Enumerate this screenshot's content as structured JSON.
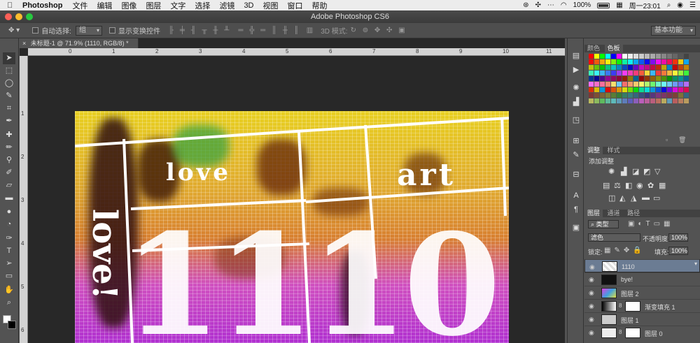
{
  "menubar": {
    "app_name": "Photoshop",
    "items": [
      "文件",
      "编辑",
      "图像",
      "图层",
      "文字",
      "选择",
      "滤镜",
      "3D",
      "视图",
      "窗口",
      "帮助"
    ],
    "battery": "100%",
    "clock": "周一23:01"
  },
  "titlebar": {
    "title": "Adobe Photoshop CS6"
  },
  "options": {
    "auto_select_label": "自动选择:",
    "auto_select_value": "组",
    "show_transform_label": "显示变换控件",
    "mode_3d_label": "3D 模式:",
    "workspace": "基本功能"
  },
  "document": {
    "tab_title": "未标题-1 @ 71.9% (1110, RGB/8) *",
    "ruler_top": [
      "0",
      "1",
      "2",
      "3",
      "4",
      "5",
      "6",
      "7",
      "8",
      "9",
      "10",
      "11"
    ],
    "ruler_left": [
      "1",
      "2",
      "3",
      "4",
      "5",
      "6"
    ],
    "artwork_texts": [
      "love",
      "art",
      "1110",
      "love!"
    ]
  },
  "panels": {
    "color_tabs": [
      "颜色",
      "色板"
    ],
    "adjust_tabs": [
      "调整",
      "样式"
    ],
    "adjust_title": "添加调整",
    "layers_tabs": [
      "图层",
      "通道",
      "路径"
    ],
    "filter_kind": "类型",
    "blend_mode": "滤色",
    "opacity_label": "不透明度:",
    "opacity_value": "100%",
    "lock_label": "锁定:",
    "fill_label": "填充:",
    "fill_value": "100%",
    "layers": [
      {
        "name": "1110"
      },
      {
        "name": "bye!"
      },
      {
        "name": "图层 2"
      },
      {
        "name": "渐变填充 1"
      },
      {
        "name": "图层 1"
      },
      {
        "name": "图层 0"
      }
    ]
  },
  "colors": {
    "accent": "#6b7c93",
    "panel_bg": "#535353",
    "canvas_bg": "#282828"
  }
}
